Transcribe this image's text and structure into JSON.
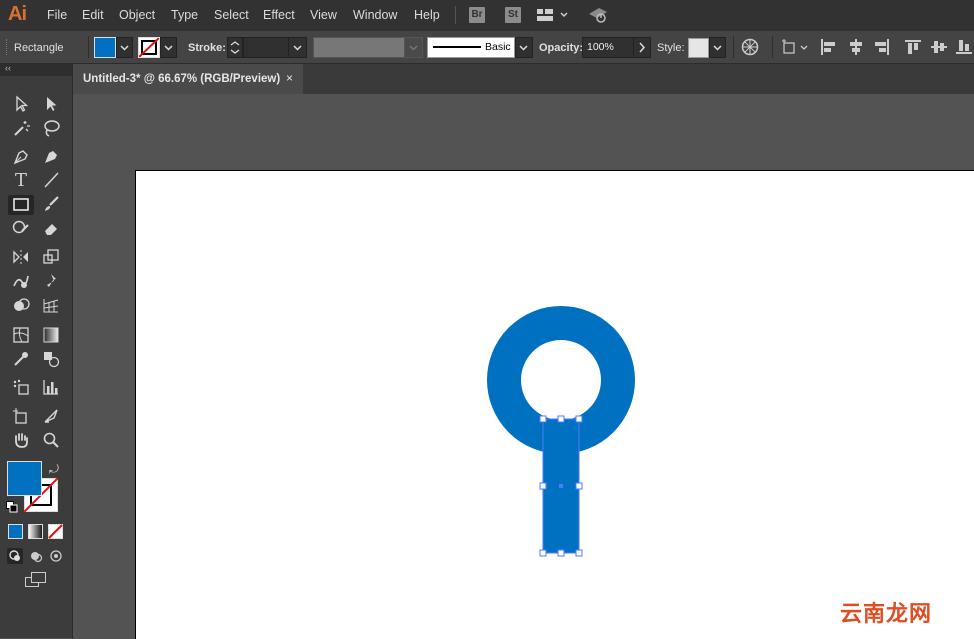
{
  "app": {
    "logo": "Ai"
  },
  "menubar": {
    "items": [
      "File",
      "Edit",
      "Object",
      "Type",
      "Select",
      "Effect",
      "View",
      "Window",
      "Help"
    ],
    "bridge": "Br",
    "stock": "St"
  },
  "controlbar": {
    "tool_name": "Rectangle",
    "fill_color": "#0070c0",
    "stroke_label": "Stroke:",
    "brush_label": "Basic",
    "opacity_label": "Opacity:",
    "opacity_value": "100%",
    "style_label": "Style:"
  },
  "document": {
    "tab_title": "Untitled-3* @ 66.67% (RGB/Preview)",
    "close_glyph": "×"
  },
  "artwork": {
    "shape_color": "#0070c0",
    "selection_color": "#4b7bff"
  },
  "toolbar": {
    "fill_color": "#0070c0",
    "collapse_glyph": "‹‹"
  },
  "watermark": "云南龙网"
}
